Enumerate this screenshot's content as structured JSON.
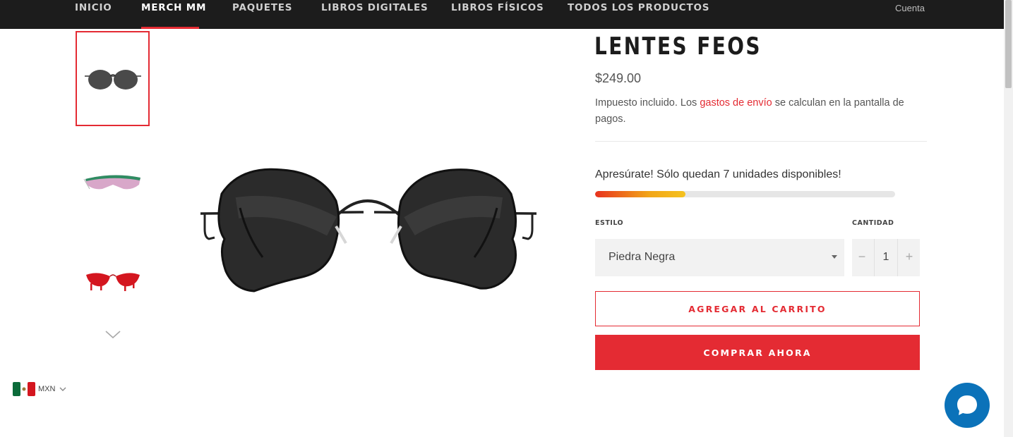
{
  "nav": {
    "items": [
      {
        "label": "INICIO"
      },
      {
        "label": "MERCH MM"
      },
      {
        "label": "PAQUETES"
      },
      {
        "label": "LIBROS DIGITALES"
      },
      {
        "label": "LIBROS FÍSICOS"
      },
      {
        "label": "TODOS LOS PRODUCTOS"
      }
    ],
    "active_index": 1,
    "account_label": "Cuenta"
  },
  "gallery": {
    "thumbnails": [
      {
        "name": "black-round-sunglasses",
        "selected": true
      },
      {
        "name": "pink-green-visor-sunglasses",
        "selected": false
      },
      {
        "name": "red-dripping-sunglasses",
        "selected": false
      }
    ],
    "down_icon": "chevron-down-icon"
  },
  "product": {
    "title": "LENTES FEOS",
    "price": "$249.00",
    "tax_prefix": "Impuesto incluido. Los ",
    "tax_link": "gastos de envío",
    "tax_suffix": " se calculan en la pantalla de pagos.",
    "stock_message": "Apresúrate! Sólo quedan 7 unidades disponibles!",
    "stock_fraction": 0.3
  },
  "options": {
    "style_label": "ESTILO",
    "style_value": "Piedra Negra",
    "quantity_label": "CANTIDAD",
    "quantity_value": "1",
    "minus": "−",
    "plus": "+"
  },
  "buttons": {
    "add_to_cart": "AGREGAR AL CARRITO",
    "buy_now": "COMPRAR AHORA"
  },
  "currency": {
    "code": "MXN"
  },
  "colors": {
    "accent": "#e42b33",
    "nav_bg": "#1c1c1c",
    "chat": "#0b72b9"
  }
}
